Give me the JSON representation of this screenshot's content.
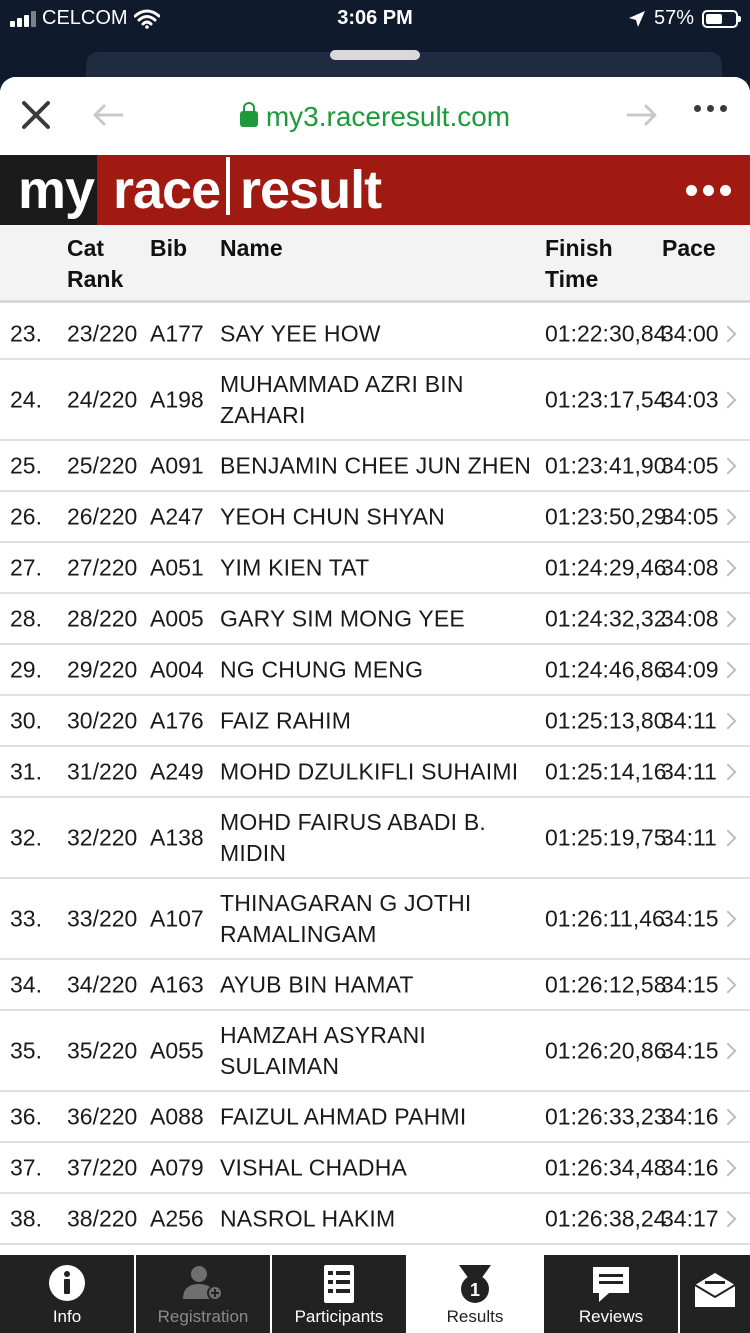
{
  "status_bar": {
    "carrier": "CELCOM",
    "time": "3:06 PM",
    "battery": "57%",
    "battery_level": 0.57
  },
  "browser": {
    "url": "my3.raceresult.com"
  },
  "brand": {
    "my": "my",
    "race": "race",
    "result": "result"
  },
  "table": {
    "headers": {
      "cat_rank_1": "Cat",
      "cat_rank_2": "Rank",
      "bib": "Bib",
      "name": "Name",
      "finish_1": "Finish",
      "finish_2": "Time",
      "pace": "Pace"
    },
    "rows": [
      {
        "pos": "23.",
        "cat_rank": "23/220",
        "bib": "A177",
        "name": "SAY YEE HOW",
        "finish": "01:22:30,84",
        "pace": "34:00"
      },
      {
        "pos": "24.",
        "cat_rank": "24/220",
        "bib": "A198",
        "name": "MUHAMMAD AZRI BIN ZAHARI",
        "finish": "01:23:17,54",
        "pace": "34:03"
      },
      {
        "pos": "25.",
        "cat_rank": "25/220",
        "bib": "A091",
        "name": "BENJAMIN CHEE JUN ZHEN",
        "finish": "01:23:41,90",
        "pace": "34:05"
      },
      {
        "pos": "26.",
        "cat_rank": "26/220",
        "bib": "A247",
        "name": "YEOH CHUN SHYAN",
        "finish": "01:23:50,29",
        "pace": "34:05"
      },
      {
        "pos": "27.",
        "cat_rank": "27/220",
        "bib": "A051",
        "name": "YIM KIEN TAT",
        "finish": "01:24:29,46",
        "pace": "34:08"
      },
      {
        "pos": "28.",
        "cat_rank": "28/220",
        "bib": "A005",
        "name": "GARY SIM MONG YEE",
        "finish": "01:24:32,32",
        "pace": "34:08"
      },
      {
        "pos": "29.",
        "cat_rank": "29/220",
        "bib": "A004",
        "name": "NG CHUNG MENG",
        "finish": "01:24:46,86",
        "pace": "34:09"
      },
      {
        "pos": "30.",
        "cat_rank": "30/220",
        "bib": "A176",
        "name": "FAIZ RAHIM",
        "finish": "01:25:13,80",
        "pace": "34:11"
      },
      {
        "pos": "31.",
        "cat_rank": "31/220",
        "bib": "A249",
        "name": "MOHD DZULKIFLI SUHAIMI",
        "finish": "01:25:14,16",
        "pace": "34:11"
      },
      {
        "pos": "32.",
        "cat_rank": "32/220",
        "bib": "A138",
        "name": "MOHD FAIRUS ABADI B. MIDIN",
        "finish": "01:25:19,75",
        "pace": "34:11"
      },
      {
        "pos": "33.",
        "cat_rank": "33/220",
        "bib": "A107",
        "name": "THINAGARAN G JOTHI RAMALINGAM",
        "finish": "01:26:11,46",
        "pace": "34:15"
      },
      {
        "pos": "34.",
        "cat_rank": "34/220",
        "bib": "A163",
        "name": "AYUB BIN HAMAT",
        "finish": "01:26:12,58",
        "pace": "34:15"
      },
      {
        "pos": "35.",
        "cat_rank": "35/220",
        "bib": "A055",
        "name": "HAMZAH ASYRANI SULAIMAN",
        "finish": "01:26:20,86",
        "pace": "34:15"
      },
      {
        "pos": "36.",
        "cat_rank": "36/220",
        "bib": "A088",
        "name": "FAIZUL AHMAD PAHMI",
        "finish": "01:26:33,23",
        "pace": "34:16"
      },
      {
        "pos": "37.",
        "cat_rank": "37/220",
        "bib": "A079",
        "name": "VISHAL CHADHA",
        "finish": "01:26:34,48",
        "pace": "34:16"
      },
      {
        "pos": "38.",
        "cat_rank": "38/220",
        "bib": "A256",
        "name": "NASROL HAKIM",
        "finish": "01:26:38,24",
        "pace": "34:17"
      }
    ]
  },
  "tabs": [
    {
      "label": "Info",
      "icon": "info-icon",
      "state": "normal"
    },
    {
      "label": "Registration",
      "icon": "add-user-icon",
      "state": "disabled"
    },
    {
      "label": "Participants",
      "icon": "list-icon",
      "state": "normal"
    },
    {
      "label": "Results",
      "icon": "medal-icon",
      "state": "active"
    },
    {
      "label": "Reviews",
      "icon": "chat-icon",
      "state": "normal"
    },
    {
      "label": "",
      "icon": "envelope-icon",
      "state": "normal"
    }
  ],
  "colors": {
    "brand_red": "#a11a12",
    "url_green": "#1c9a3c",
    "tab_bg": "#222222"
  }
}
